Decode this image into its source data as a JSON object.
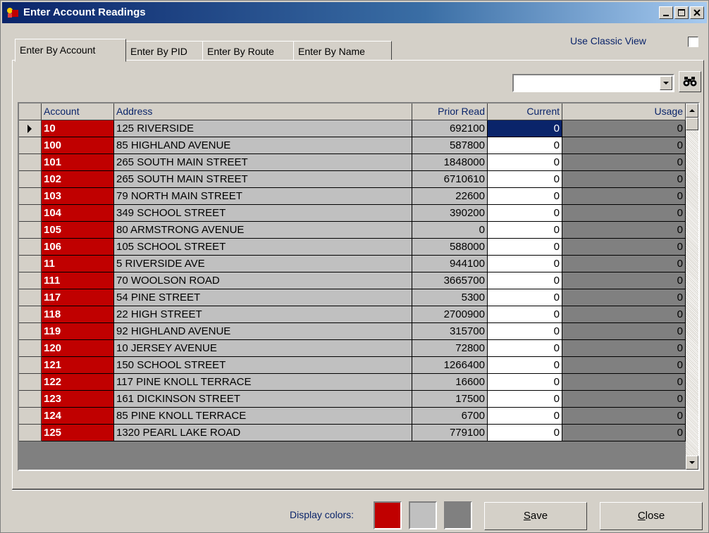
{
  "window": {
    "title": "Enter Account Readings",
    "minimize": "_",
    "maximize": "□",
    "close": "×"
  },
  "tabs": [
    "Enter By Account",
    "Enter By PID",
    "Enter By Route",
    "Enter By Name"
  ],
  "active_tab": "Enter By Account",
  "classic_view": {
    "label": "Use Classic View",
    "checked": false
  },
  "search": {
    "value": "",
    "icon": "binoculars-icon"
  },
  "columns": [
    "Account",
    "Address",
    "Prior Read",
    "Current",
    "Usage"
  ],
  "rows": [
    {
      "account": "10",
      "address": "125 RIVERSIDE",
      "prior": "692100",
      "current": "0",
      "usage": "0"
    },
    {
      "account": "100",
      "address": "85 HIGHLAND AVENUE",
      "prior": "587800",
      "current": "0",
      "usage": "0"
    },
    {
      "account": "101",
      "address": "265 SOUTH MAIN STREET",
      "prior": "1848000",
      "current": "0",
      "usage": "0"
    },
    {
      "account": "102",
      "address": "265 SOUTH MAIN STREET",
      "prior": "6710610",
      "current": "0",
      "usage": "0"
    },
    {
      "account": "103",
      "address": "79 NORTH MAIN STREET",
      "prior": "22600",
      "current": "0",
      "usage": "0"
    },
    {
      "account": "104",
      "address": "349 SCHOOL STREET",
      "prior": "390200",
      "current": "0",
      "usage": "0"
    },
    {
      "account": "105",
      "address": "80 ARMSTRONG AVENUE",
      "prior": "0",
      "current": "0",
      "usage": "0"
    },
    {
      "account": "106",
      "address": "105 SCHOOL STREET",
      "prior": "588000",
      "current": "0",
      "usage": "0"
    },
    {
      "account": "11",
      "address": "5 RIVERSIDE AVE",
      "prior": "944100",
      "current": "0",
      "usage": "0"
    },
    {
      "account": "111",
      "address": "70 WOOLSON ROAD",
      "prior": "3665700",
      "current": "0",
      "usage": "0"
    },
    {
      "account": "117",
      "address": "54 PINE STREET",
      "prior": "5300",
      "current": "0",
      "usage": "0"
    },
    {
      "account": "118",
      "address": "22 HIGH STREET",
      "prior": "2700900",
      "current": "0",
      "usage": "0"
    },
    {
      "account": "119",
      "address": "92 HIGHLAND AVENUE",
      "prior": "315700",
      "current": "0",
      "usage": "0"
    },
    {
      "account": "120",
      "address": "10 JERSEY AVENUE",
      "prior": "72800",
      "current": "0",
      "usage": "0"
    },
    {
      "account": "121",
      "address": "150 SCHOOL STREET",
      "prior": "1266400",
      "current": "0",
      "usage": "0"
    },
    {
      "account": "122",
      "address": "117 PINE KNOLL TERRACE",
      "prior": "16600",
      "current": "0",
      "usage": "0"
    },
    {
      "account": "123",
      "address": "161 DICKINSON STREET",
      "prior": "17500",
      "current": "0",
      "usage": "0"
    },
    {
      "account": "124",
      "address": "85 PINE KNOLL TERRACE",
      "prior": "6700",
      "current": "0",
      "usage": "0"
    },
    {
      "account": "125",
      "address": "1320 PEARL LAKE ROAD",
      "prior": "779100",
      "current": "0",
      "usage": "0"
    }
  ],
  "selected_row": 0,
  "display_colors": {
    "label": "Display colors:",
    "swatches": [
      "#c00000",
      "#c0c0c0",
      "#808080"
    ]
  },
  "buttons": {
    "save": "Save",
    "close": "Close"
  }
}
